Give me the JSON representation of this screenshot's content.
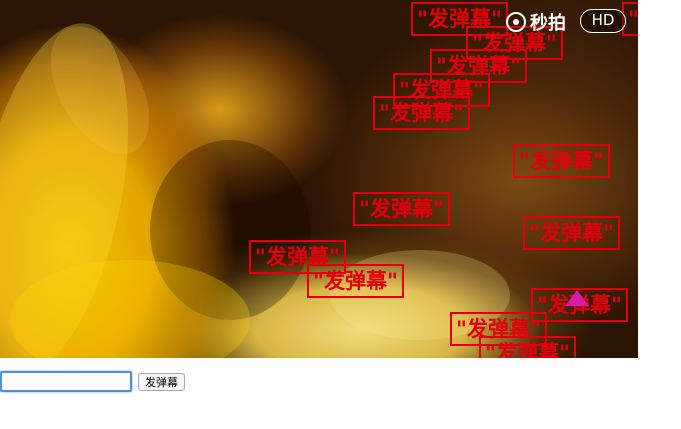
{
  "video": {
    "logo_text": "秒拍",
    "quality_label": "HD"
  },
  "danmaku": [
    {
      "text": "\"发弹幕\""
    },
    {
      "text": "\"发弹幕\""
    },
    {
      "text": "\"发弹幕\""
    },
    {
      "text": "\"发弹幕\""
    },
    {
      "text": "\"发弹幕\""
    },
    {
      "text": "\"发弹幕\""
    },
    {
      "text": "\"发弹幕\""
    },
    {
      "text": "\"发弹幕\""
    },
    {
      "text": "\"发弹幕\""
    },
    {
      "text": "\"发弹幕\""
    },
    {
      "text": "\"发弹幕\""
    },
    {
      "text": "\"发弹幕\""
    },
    {
      "text": "\"发弹幕\""
    },
    {
      "text": "\"发弹幕\""
    }
  ],
  "form": {
    "input_value": "",
    "send_label": "发弹幕"
  },
  "colors": {
    "danmu_red": "#e3000b",
    "watermark_magenta": "#d81aa5",
    "input_focus": "#4a90e2"
  },
  "icons": {
    "logo": "miaopai-eye-icon",
    "watermark": "triangle-watermark-icon"
  }
}
